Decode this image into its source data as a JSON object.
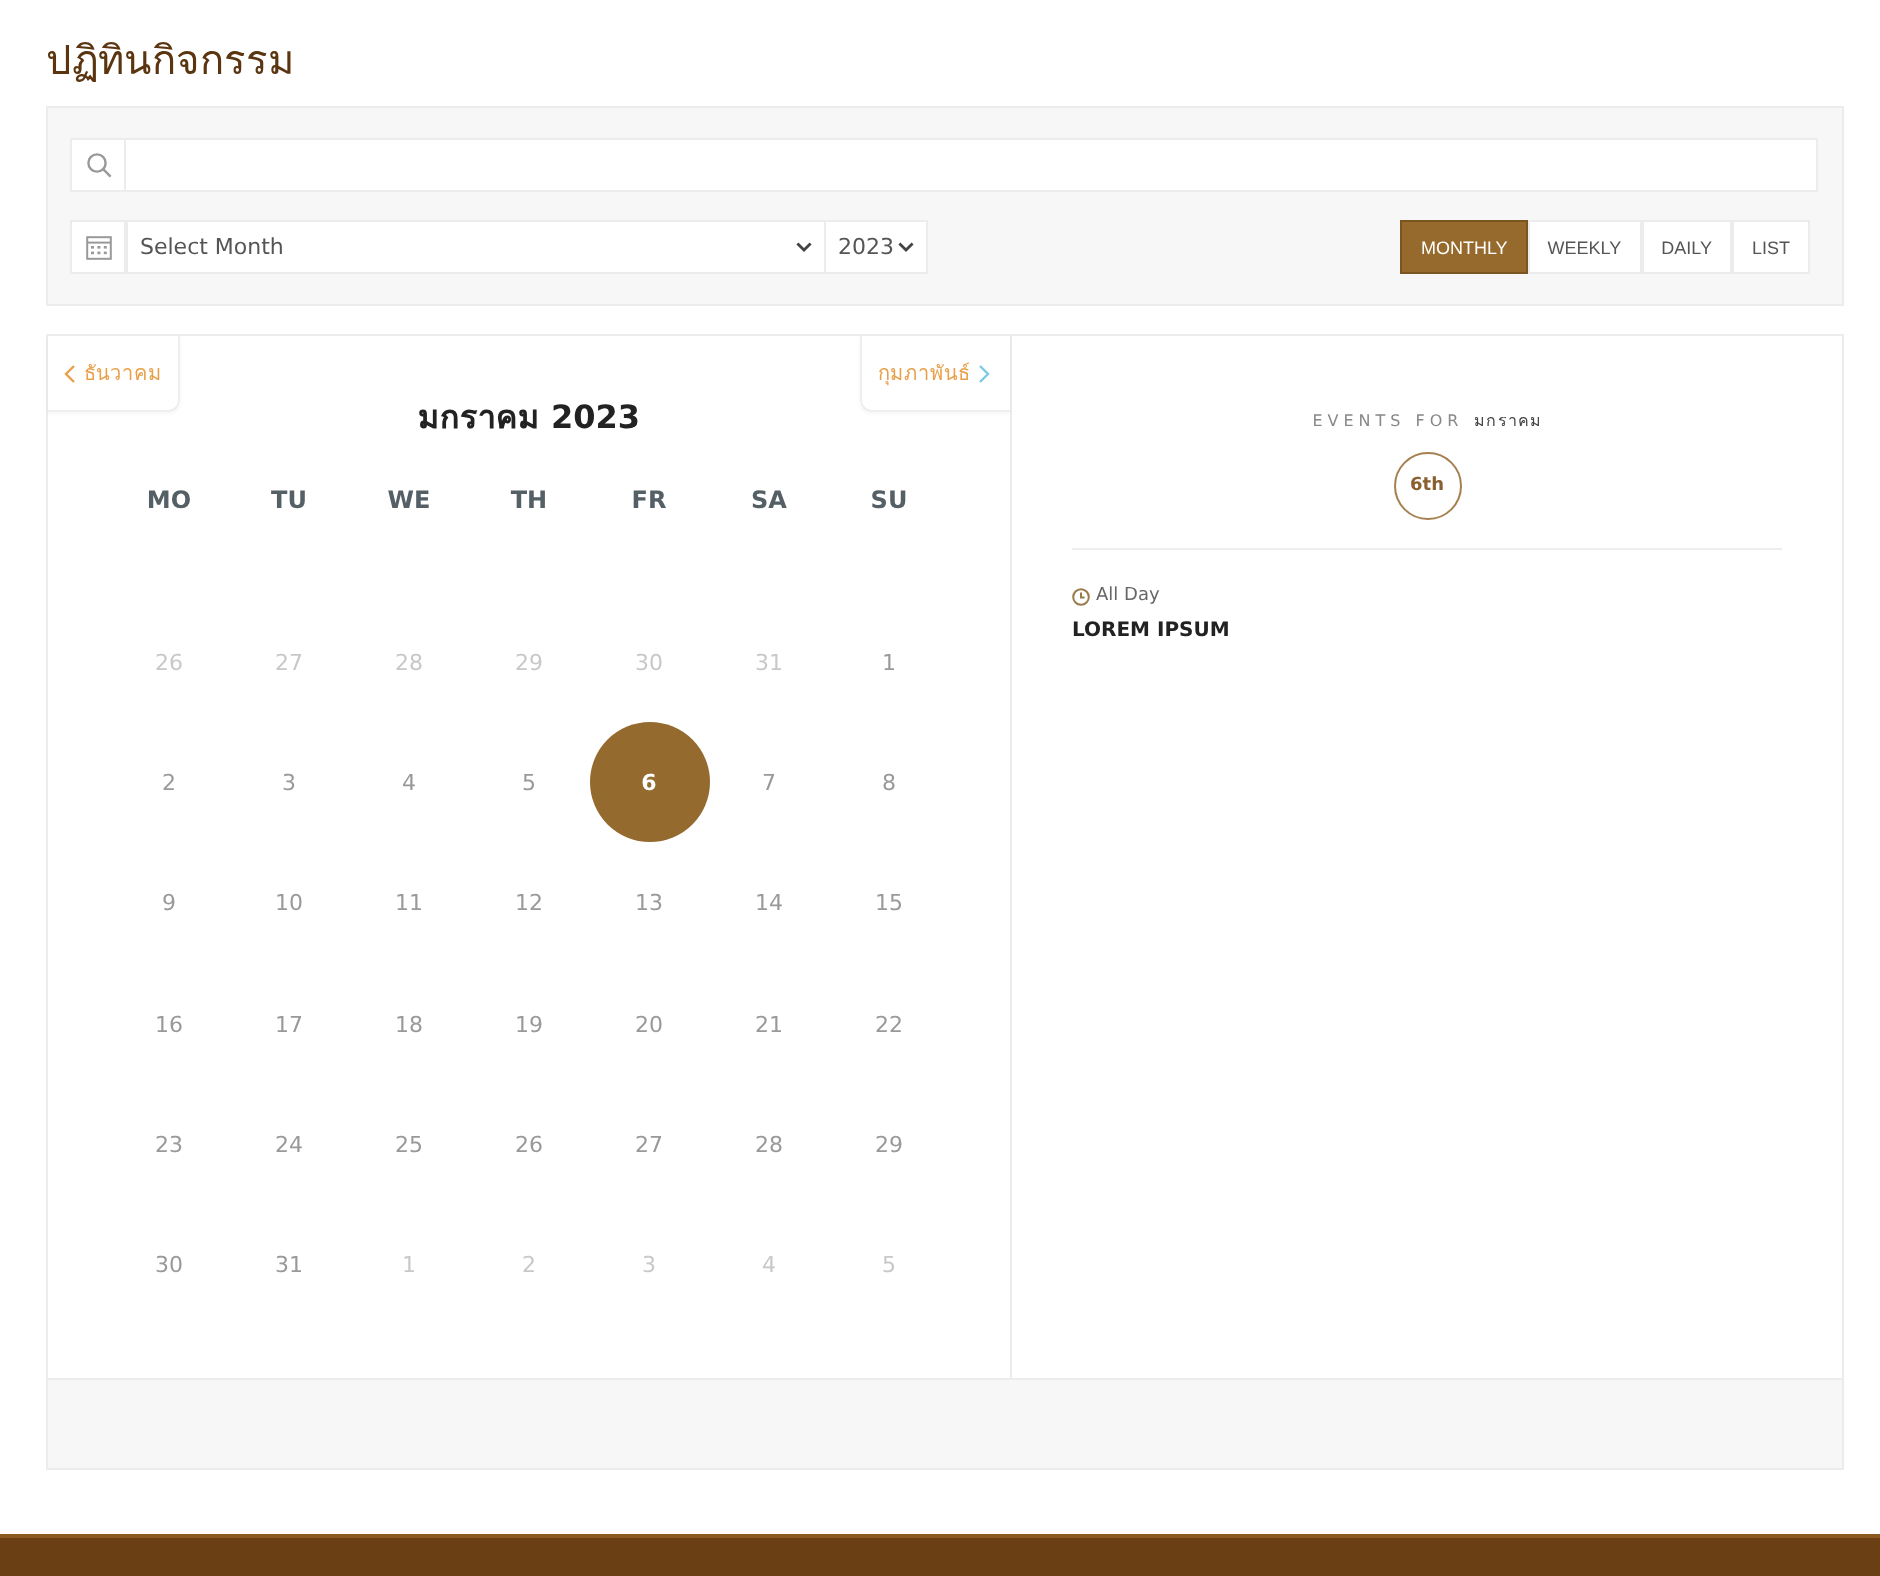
{
  "page_title": "ปฏิทินกิจกรรม",
  "filters": {
    "month_select": {
      "value": "Select Month"
    },
    "year_select": {
      "value": "2023"
    },
    "views": [
      {
        "label": "MONTHLY",
        "selected": true
      },
      {
        "label": "WEEKLY",
        "selected": false
      },
      {
        "label": "DAILY",
        "selected": false
      },
      {
        "label": "LIST",
        "selected": false
      }
    ]
  },
  "calendar": {
    "prev": "ธันวาคม",
    "next": "กุมภาพันธ์",
    "title": "มกราคม 2023",
    "weekdays": [
      "MO",
      "TU",
      "WE",
      "TH",
      "FR",
      "SA",
      "SU"
    ],
    "days": [
      {
        "label": "26",
        "muted": true,
        "selected": false
      },
      {
        "label": "27",
        "muted": true,
        "selected": false
      },
      {
        "label": "28",
        "muted": true,
        "selected": false
      },
      {
        "label": "29",
        "muted": true,
        "selected": false
      },
      {
        "label": "30",
        "muted": true,
        "selected": false
      },
      {
        "label": "31",
        "muted": true,
        "selected": false
      },
      {
        "label": "1",
        "muted": false,
        "selected": false
      },
      {
        "label": "2",
        "muted": false,
        "selected": false
      },
      {
        "label": "3",
        "muted": false,
        "selected": false
      },
      {
        "label": "4",
        "muted": false,
        "selected": false
      },
      {
        "label": "5",
        "muted": false,
        "selected": false
      },
      {
        "label": "6",
        "muted": false,
        "selected": true
      },
      {
        "label": "7",
        "muted": false,
        "selected": false
      },
      {
        "label": "8",
        "muted": false,
        "selected": false
      },
      {
        "label": "9",
        "muted": false,
        "selected": false
      },
      {
        "label": "10",
        "muted": false,
        "selected": false
      },
      {
        "label": "11",
        "muted": false,
        "selected": false
      },
      {
        "label": "12",
        "muted": false,
        "selected": false
      },
      {
        "label": "13",
        "muted": false,
        "selected": false
      },
      {
        "label": "14",
        "muted": false,
        "selected": false
      },
      {
        "label": "15",
        "muted": false,
        "selected": false
      },
      {
        "label": "16",
        "muted": false,
        "selected": false
      },
      {
        "label": "17",
        "muted": false,
        "selected": false
      },
      {
        "label": "18",
        "muted": false,
        "selected": false
      },
      {
        "label": "19",
        "muted": false,
        "selected": false
      },
      {
        "label": "20",
        "muted": false,
        "selected": false
      },
      {
        "label": "21",
        "muted": false,
        "selected": false
      },
      {
        "label": "22",
        "muted": false,
        "selected": false
      },
      {
        "label": "23",
        "muted": false,
        "selected": false
      },
      {
        "label": "24",
        "muted": false,
        "selected": false
      },
      {
        "label": "25",
        "muted": false,
        "selected": false
      },
      {
        "label": "26",
        "muted": false,
        "selected": false
      },
      {
        "label": "27",
        "muted": false,
        "selected": false
      },
      {
        "label": "28",
        "muted": false,
        "selected": false
      },
      {
        "label": "29",
        "muted": false,
        "selected": false
      },
      {
        "label": "30",
        "muted": false,
        "selected": false
      },
      {
        "label": "31",
        "muted": false,
        "selected": false
      },
      {
        "label": "1",
        "muted": true,
        "selected": false
      },
      {
        "label": "2",
        "muted": true,
        "selected": false
      },
      {
        "label": "3",
        "muted": true,
        "selected": false
      },
      {
        "label": "4",
        "muted": true,
        "selected": false
      },
      {
        "label": "5",
        "muted": true,
        "selected": false
      }
    ]
  },
  "events_panel": {
    "heading_prefix": "EVENTS FOR",
    "heading_month": "มกราคม",
    "day_badge": "6th",
    "events": [
      {
        "time": "All Day",
        "title": "LOREM IPSUM"
      }
    ]
  }
}
